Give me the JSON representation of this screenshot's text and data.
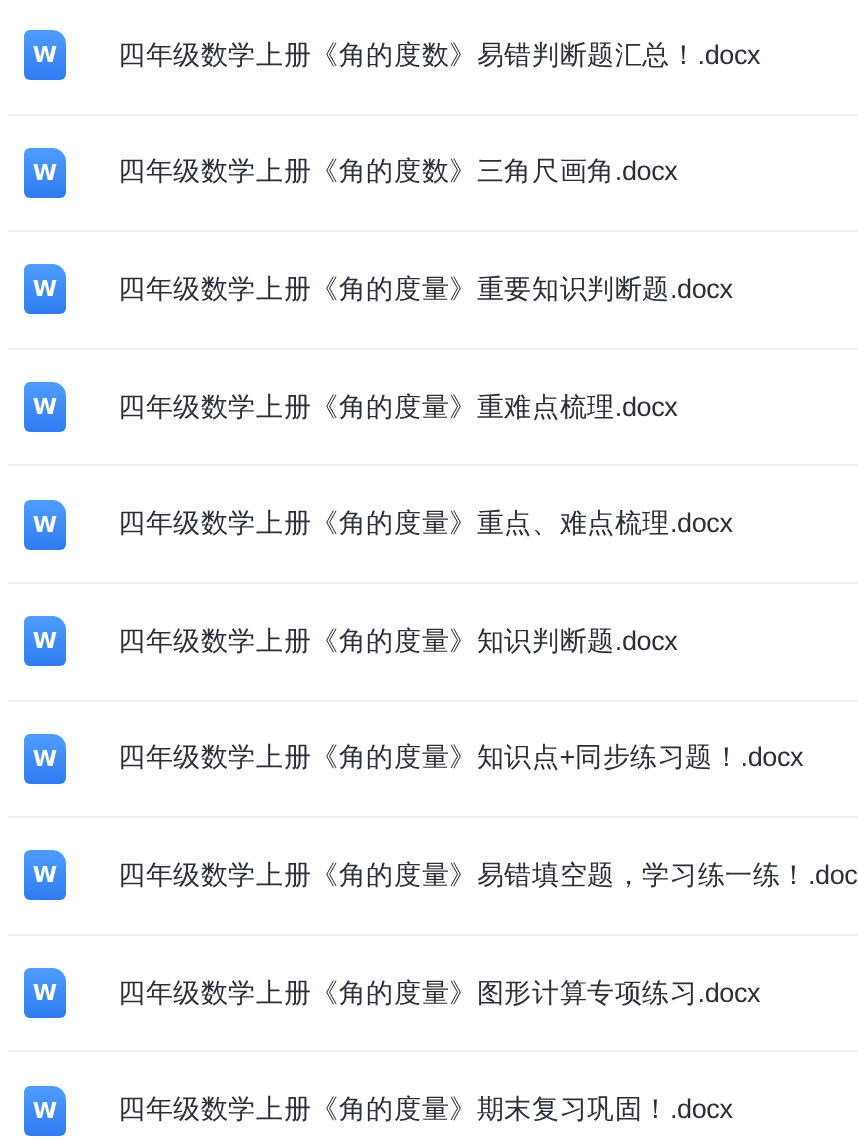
{
  "files": [
    {
      "icon_letter": "W",
      "name": "四年级数学上册《角的度数》易错判断题汇总！.docx"
    },
    {
      "icon_letter": "W",
      "name": "四年级数学上册《角的度数》三角尺画角.docx"
    },
    {
      "icon_letter": "W",
      "name": "四年级数学上册《角的度量》重要知识判断题.docx"
    },
    {
      "icon_letter": "W",
      "name": "四年级数学上册《角的度量》重难点梳理.docx"
    },
    {
      "icon_letter": "W",
      "name": "四年级数学上册《角的度量》重点、难点梳理.docx"
    },
    {
      "icon_letter": "W",
      "name": "四年级数学上册《角的度量》知识判断题.docx"
    },
    {
      "icon_letter": "W",
      "name": "四年级数学上册《角的度量》知识点+同步练习题！.docx"
    },
    {
      "icon_letter": "W",
      "name": "四年级数学上册《角的度量》易错填空题，学习练一练！.doc"
    },
    {
      "icon_letter": "W",
      "name": "四年级数学上册《角的度量》图形计算专项练习.docx"
    },
    {
      "icon_letter": "W",
      "name": "四年级数学上册《角的度量》期末复习巩固！.docx"
    }
  ]
}
